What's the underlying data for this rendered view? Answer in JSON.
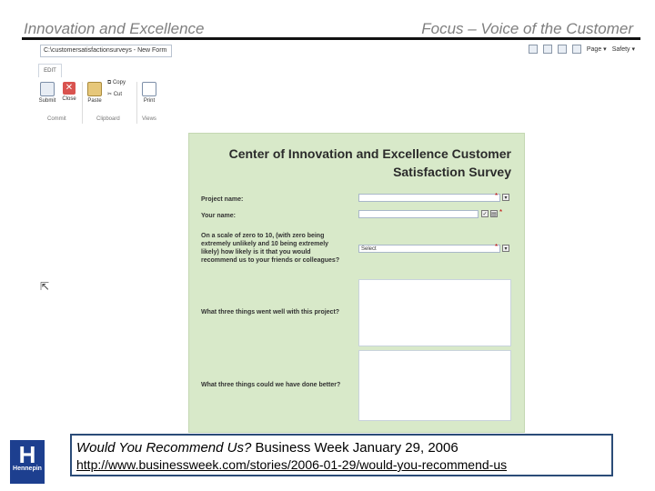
{
  "slide": {
    "header_left": "Innovation and Excellence",
    "header_right": "Focus – Voice of the Customer"
  },
  "browser": {
    "address": "C:\\customersatisfactionsurveys - New Form",
    "tools": [
      "Page ▾",
      "Safety ▾"
    ]
  },
  "ribbon": {
    "tab": "EDIT",
    "buttons": {
      "submit": "Submit",
      "close": "Close",
      "paste": "Paste",
      "copy": "Copy",
      "cut": "Cut",
      "print": "Print"
    },
    "groups": {
      "commit": "Commit",
      "clipboard": "Clipboard",
      "views": "Views"
    }
  },
  "form": {
    "title_line1": "Center of Innovation and Excellence Customer",
    "title_line2": "Satisfaction Survey",
    "project_label": "Project name:",
    "name_label": "Your name:",
    "scale_q1": "On a scale of zero to 10, (with zero being",
    "scale_q2": "extremely unlikely and 10 being extremely",
    "scale_q3": "likely) how likely is it that you would",
    "scale_q4": "recommend us to your friends or colleagues?",
    "scale_value": "Select",
    "went_well_label": "What three things went well with this project?",
    "done_better_label": "What three things could we have done better?",
    "required_mark": "*"
  },
  "logo": {
    "letter": "H",
    "name": "Hennepin"
  },
  "reference": {
    "title": "Would You Recommend Us?",
    "source": "Business Week  January 29, 2006",
    "url": "http://www.businessweek.com/stories/2006-01-29/would-you-recommend-us"
  },
  "colors": {
    "form_bg": "#d8e9c9",
    "border": "#2b4c78",
    "logo": "#1d3f8f"
  }
}
